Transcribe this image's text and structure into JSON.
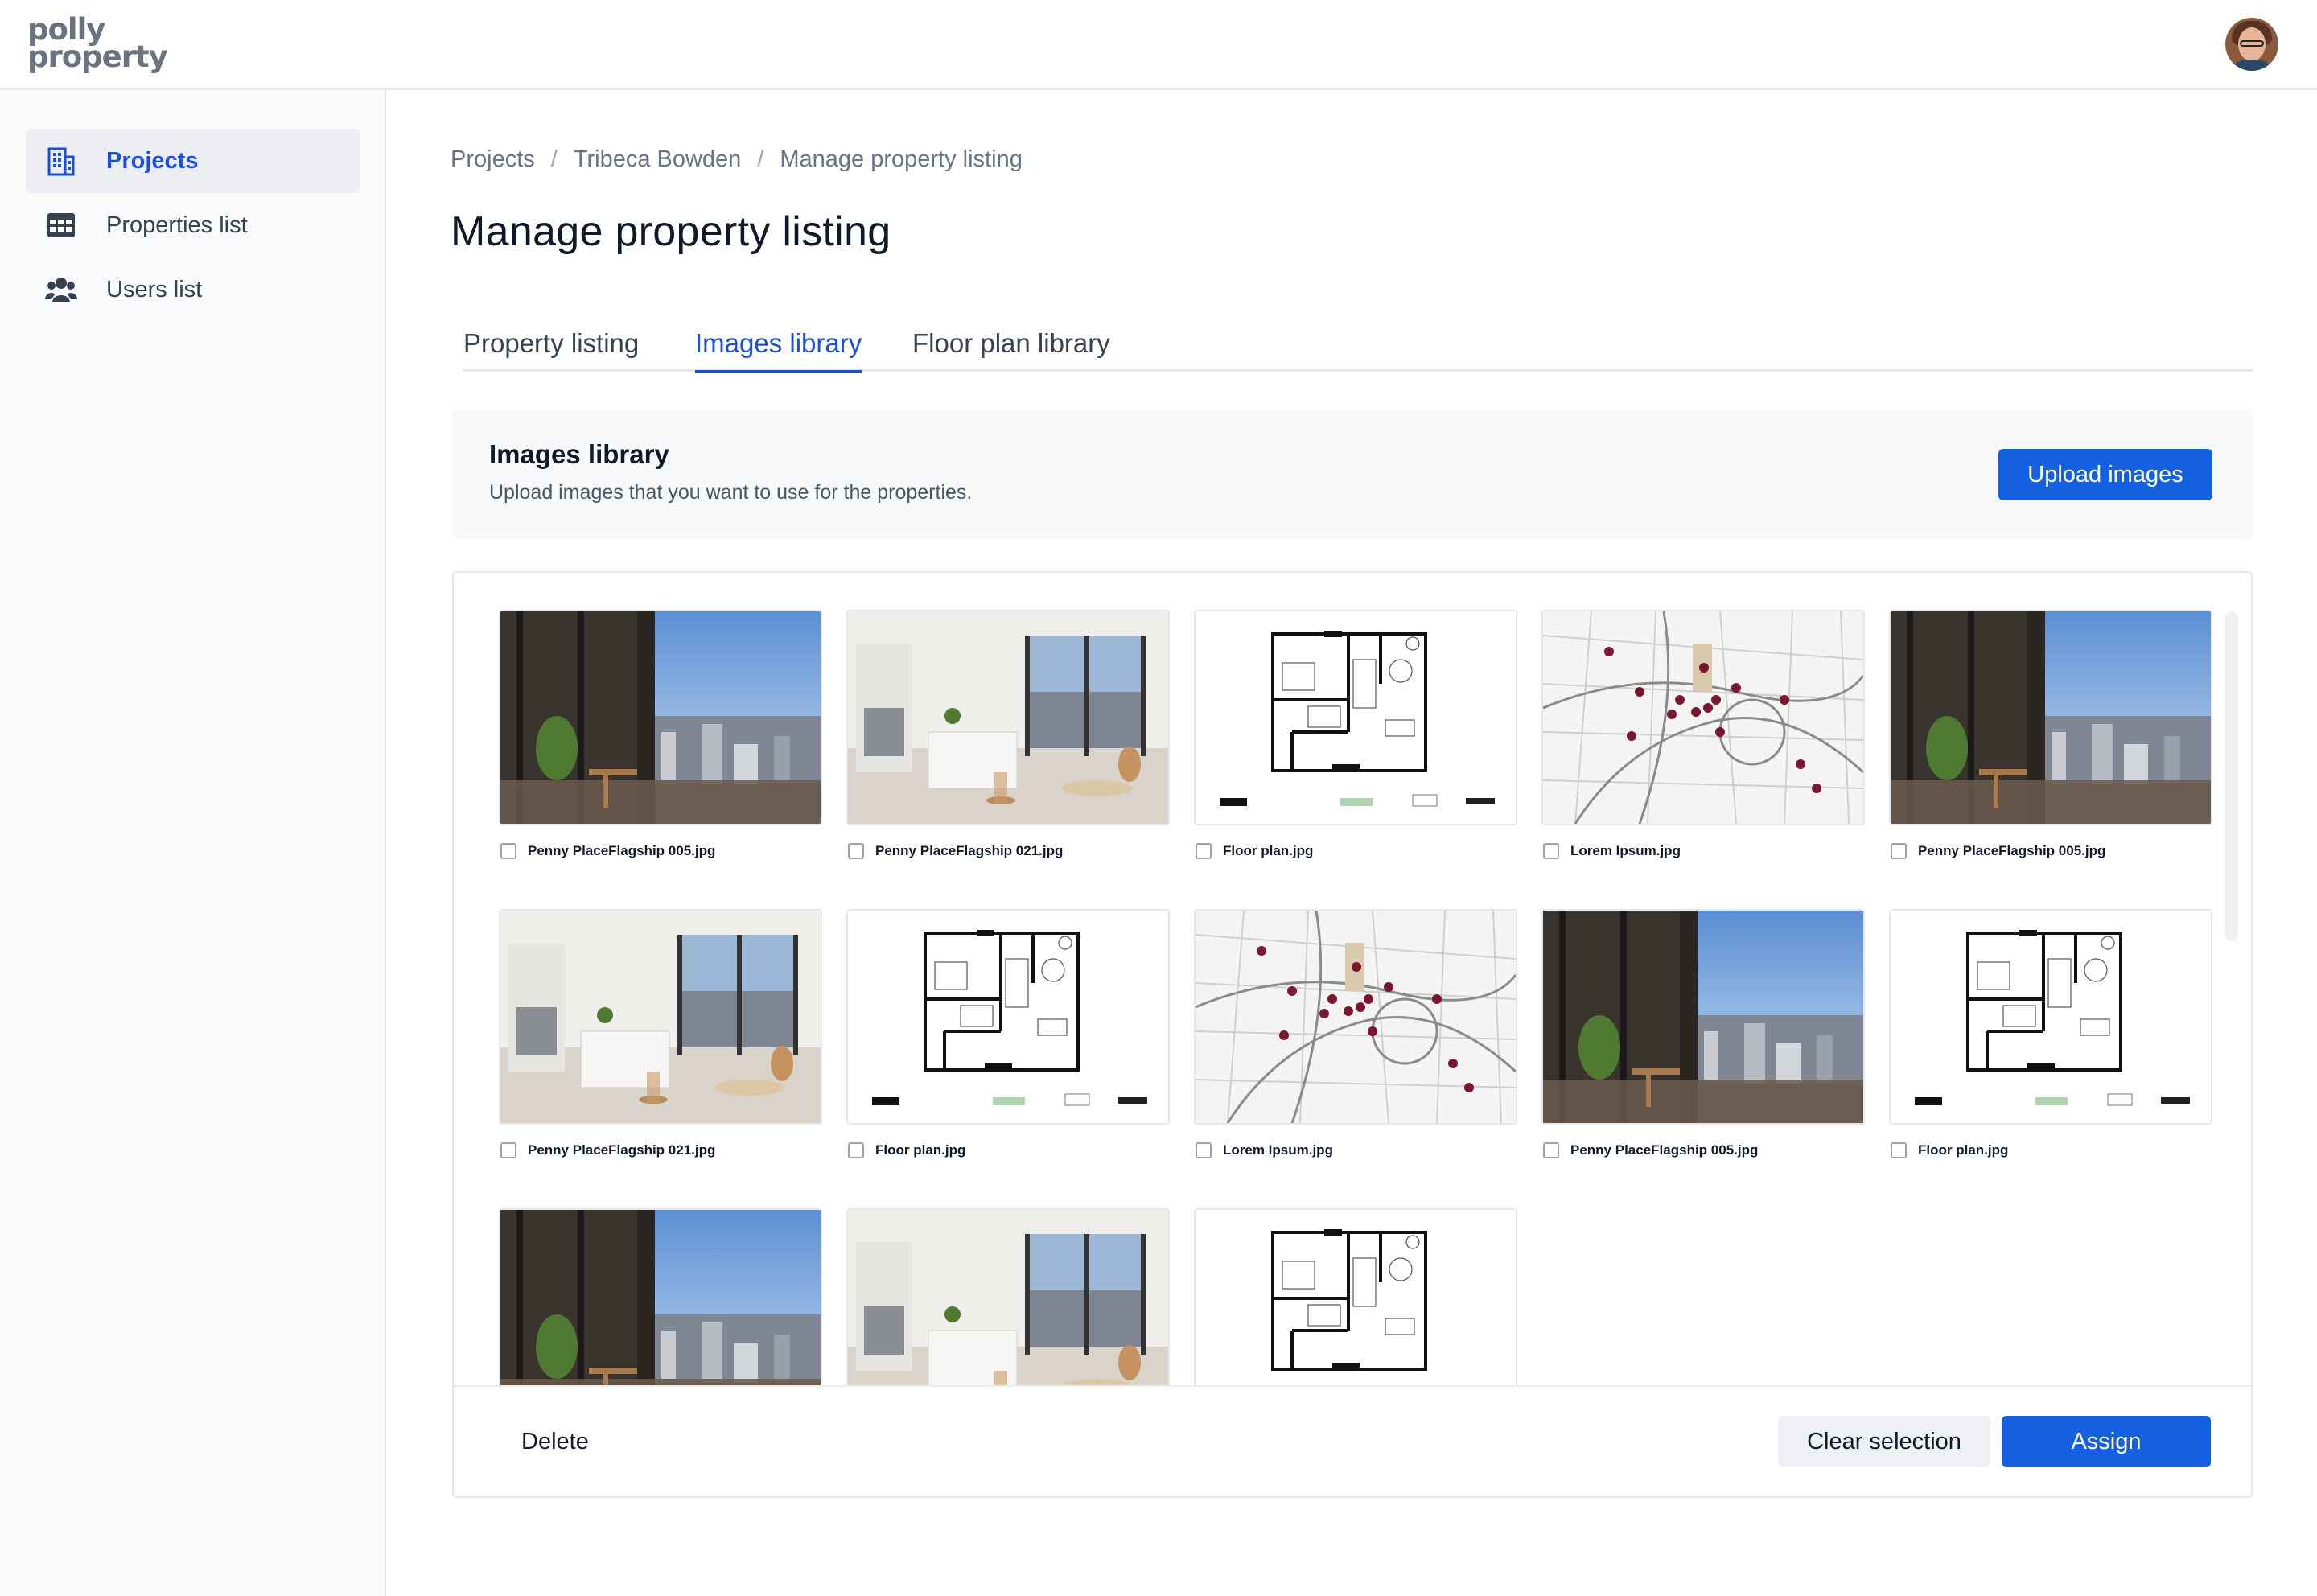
{
  "app": {
    "logo_line1": "polly",
    "logo_line2": "property"
  },
  "sidebar": {
    "items": [
      {
        "label": "Projects",
        "icon": "building-icon",
        "active": true
      },
      {
        "label": "Properties list",
        "icon": "table-icon",
        "active": false
      },
      {
        "label": "Users list",
        "icon": "users-icon",
        "active": false
      }
    ]
  },
  "breadcrumb": [
    "Projects",
    "Tribeca Bowden",
    "Manage property listing"
  ],
  "page_title": "Manage property listing",
  "tabs": [
    {
      "label": "Property listing",
      "active": false
    },
    {
      "label": "Images library",
      "active": true
    },
    {
      "label": "Floor plan library",
      "active": false
    }
  ],
  "library": {
    "title": "Images library",
    "subtitle": "Upload images that you want to use for the properties.",
    "upload_label": "Upload images"
  },
  "images": [
    {
      "name": "Penny PlaceFlagship 005.jpg",
      "kind": "balcony",
      "checked": false
    },
    {
      "name": "Penny PlaceFlagship 021.jpg",
      "kind": "interior",
      "checked": false
    },
    {
      "name": "Floor plan.jpg",
      "kind": "floorplan",
      "checked": false
    },
    {
      "name": "Lorem Ipsum.jpg",
      "kind": "map",
      "checked": false
    },
    {
      "name": "Penny PlaceFlagship 005.jpg",
      "kind": "balcony",
      "checked": false
    },
    {
      "name": "Penny PlaceFlagship 021.jpg",
      "kind": "interior",
      "checked": false
    },
    {
      "name": "Floor plan.jpg",
      "kind": "floorplan",
      "checked": false
    },
    {
      "name": "Lorem Ipsum.jpg",
      "kind": "map",
      "checked": false
    },
    {
      "name": "Penny PlaceFlagship 005.jpg",
      "kind": "balcony",
      "checked": false
    },
    {
      "name": "Floor plan.jpg",
      "kind": "floorplan",
      "checked": false
    },
    {
      "name": "",
      "kind": "balcony",
      "checked": false
    },
    {
      "name": "",
      "kind": "interior",
      "checked": false
    },
    {
      "name": "",
      "kind": "floorplan",
      "checked": false
    }
  ],
  "actions": {
    "delete_label": "Delete",
    "clear_label": "Clear selection",
    "assign_label": "Assign"
  },
  "colors": {
    "accent": "#1460e0",
    "active_text": "#1d4ed8",
    "map_pin": "#7a1630"
  }
}
